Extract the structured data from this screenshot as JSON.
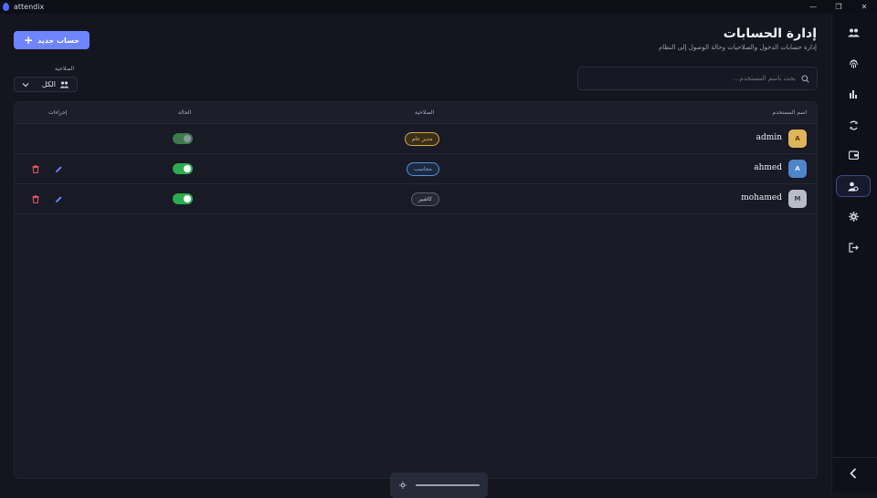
{
  "app": {
    "title": "attendix"
  },
  "window_controls": {
    "minimize": "—",
    "restore": "❐",
    "close": "✕"
  },
  "page": {
    "title": "إدارة الحسابات",
    "subtitle": "إدارة حسابات الدخول والصلاحيات وحالة الوصول إلى النظام",
    "add_button": "حساب جديد"
  },
  "filter": {
    "label": "الصلاحية",
    "selected": "الكل"
  },
  "search": {
    "placeholder": "بحث باسم المستخدم..."
  },
  "table": {
    "headers": {
      "username": "اسم المستخدم",
      "role": "الصلاحية",
      "status": "الحالة",
      "actions": "إجراءات"
    },
    "rows": [
      {
        "initial": "A",
        "username": "admin",
        "role": "مدير عام",
        "status_on": true,
        "editable": false
      },
      {
        "initial": "A",
        "username": "ahmed",
        "role": "محاسب",
        "status_on": true,
        "editable": true
      },
      {
        "initial": "M",
        "username": "mohamed",
        "role": "كاشير",
        "status_on": true,
        "editable": true
      }
    ]
  },
  "sidebar": {
    "items": [
      {
        "icon": "users-icon"
      },
      {
        "icon": "fingerprint-icon"
      },
      {
        "icon": "bar-chart-icon"
      },
      {
        "icon": "sync-icon"
      },
      {
        "icon": "wallet-icon"
      },
      {
        "icon": "user-settings-icon",
        "active": true
      },
      {
        "icon": "gear-icon"
      },
      {
        "icon": "logout-icon"
      }
    ],
    "collapse_icon": "chevron-left-icon"
  },
  "colors": {
    "accent": "#6f84ff",
    "admin_badge": "#d6a84a",
    "accountant_badge": "#5b8fd6",
    "cashier_badge": "#8f93a3",
    "toggle_on": "#2eaa50",
    "delete": "#e0525a",
    "edit": "#6f84ff"
  },
  "bottom_bar": {
    "icon": "brightness-icon"
  }
}
